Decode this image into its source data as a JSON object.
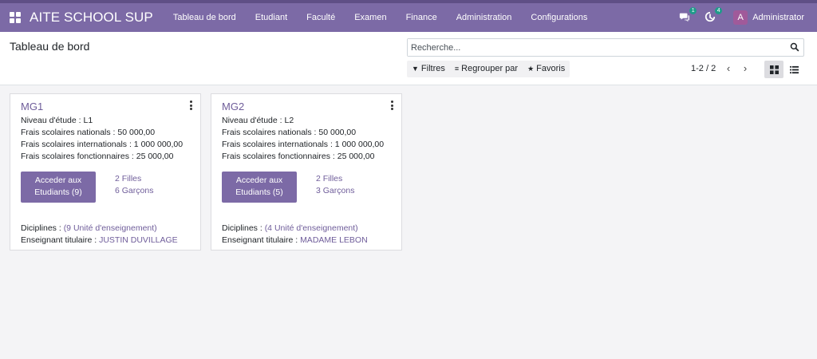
{
  "navbar": {
    "brand": "AITE SCHOOL SUP",
    "menu": [
      "Tableau de bord",
      "Etudiant",
      "Faculté",
      "Examen",
      "Finance",
      "Administration",
      "Configurations"
    ],
    "messages_badge": "1",
    "activities_badge": "4",
    "user_initial": "A",
    "user_name": "Administrator"
  },
  "control_panel": {
    "title": "Tableau de bord",
    "search_placeholder": "Recherche...",
    "filters_label": "Filtres",
    "group_by_label": "Regrouper par",
    "favorites_label": "Favoris",
    "pager": "1-2 / 2"
  },
  "cards": [
    {
      "title": "MG1",
      "level": "Niveau d'étude : L1",
      "national_fees": "Frais scolaires nationals : 50 000,00",
      "international_fees": "Frais scolaires internationals : 1 000 000,00",
      "staff_fees": "Frais scolaires fonctionnaires : 25 000,00",
      "access_line1": "Acceder aux",
      "access_line2": "Etudiants (9)",
      "girls": "2 Filles",
      "boys": "6 Garçons",
      "disciplines_label": "Diciplines : ",
      "disciplines_value": "(9 Unité d'enseignement)",
      "teacher_label": "Enseignant titulaire : ",
      "teacher_value": "JUSTIN DUVILLAGE"
    },
    {
      "title": "MG2",
      "level": "Niveau d'étude : L2",
      "national_fees": "Frais scolaires nationals : 50 000,00",
      "international_fees": "Frais scolaires internationals : 1 000 000,00",
      "staff_fees": "Frais scolaires fonctionnaires : 25 000,00",
      "access_line1": "Acceder aux",
      "access_line2": "Etudiants (5)",
      "girls": "2 Filles",
      "boys": "3 Garçons",
      "disciplines_label": "Diciplines : ",
      "disciplines_value": "(4 Unité d'enseignement)",
      "teacher_label": "Enseignant titulaire : ",
      "teacher_value": "MADAME LEBON"
    }
  ],
  "colors": {
    "navbar": "#7c6aa6",
    "accent": "#6f5d9a",
    "badge": "#1f9b8a"
  }
}
